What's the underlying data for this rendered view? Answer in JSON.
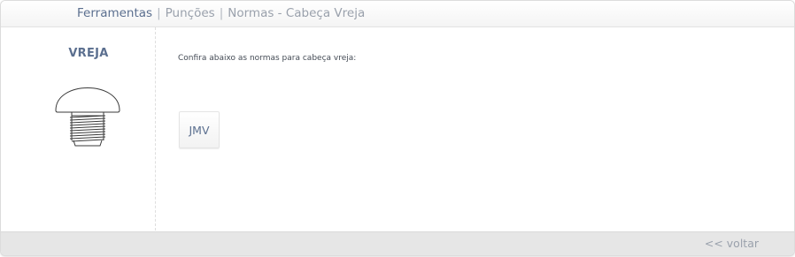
{
  "breadcrumb": {
    "items": [
      "Ferramentas",
      "Punções",
      "Normas - Cabeça Vreja"
    ],
    "separator": "|"
  },
  "product": {
    "title": "VREJA",
    "image_icon": "round-head-screw-icon"
  },
  "main": {
    "intro": "Confira abaixo as normas para cabeça vreja:",
    "norms": [
      "JMV"
    ]
  },
  "footer": {
    "back_label": "<< voltar"
  },
  "colors": {
    "accent": "#5b6f8f",
    "muted": "#9aa1ac",
    "footer_bg": "#e6e6e6"
  }
}
